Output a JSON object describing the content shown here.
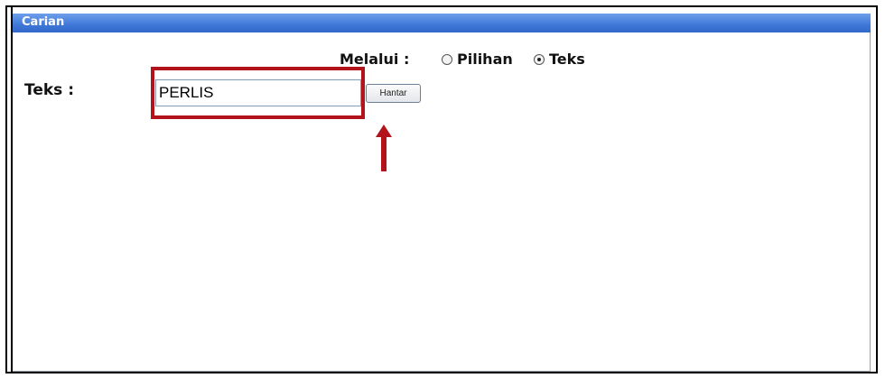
{
  "panel": {
    "title": "Carian"
  },
  "search_mode": {
    "label": "Melalui :",
    "options": [
      {
        "label": "Pilihan",
        "selected": false
      },
      {
        "label": "Teks",
        "selected": true
      }
    ]
  },
  "text_search": {
    "label": "Teks :",
    "value": "PERLIS",
    "submit_label": "Hantar"
  },
  "colors": {
    "titlebar": "#3f78d8",
    "highlight": "#b3141c",
    "arrow": "#b3141c"
  }
}
